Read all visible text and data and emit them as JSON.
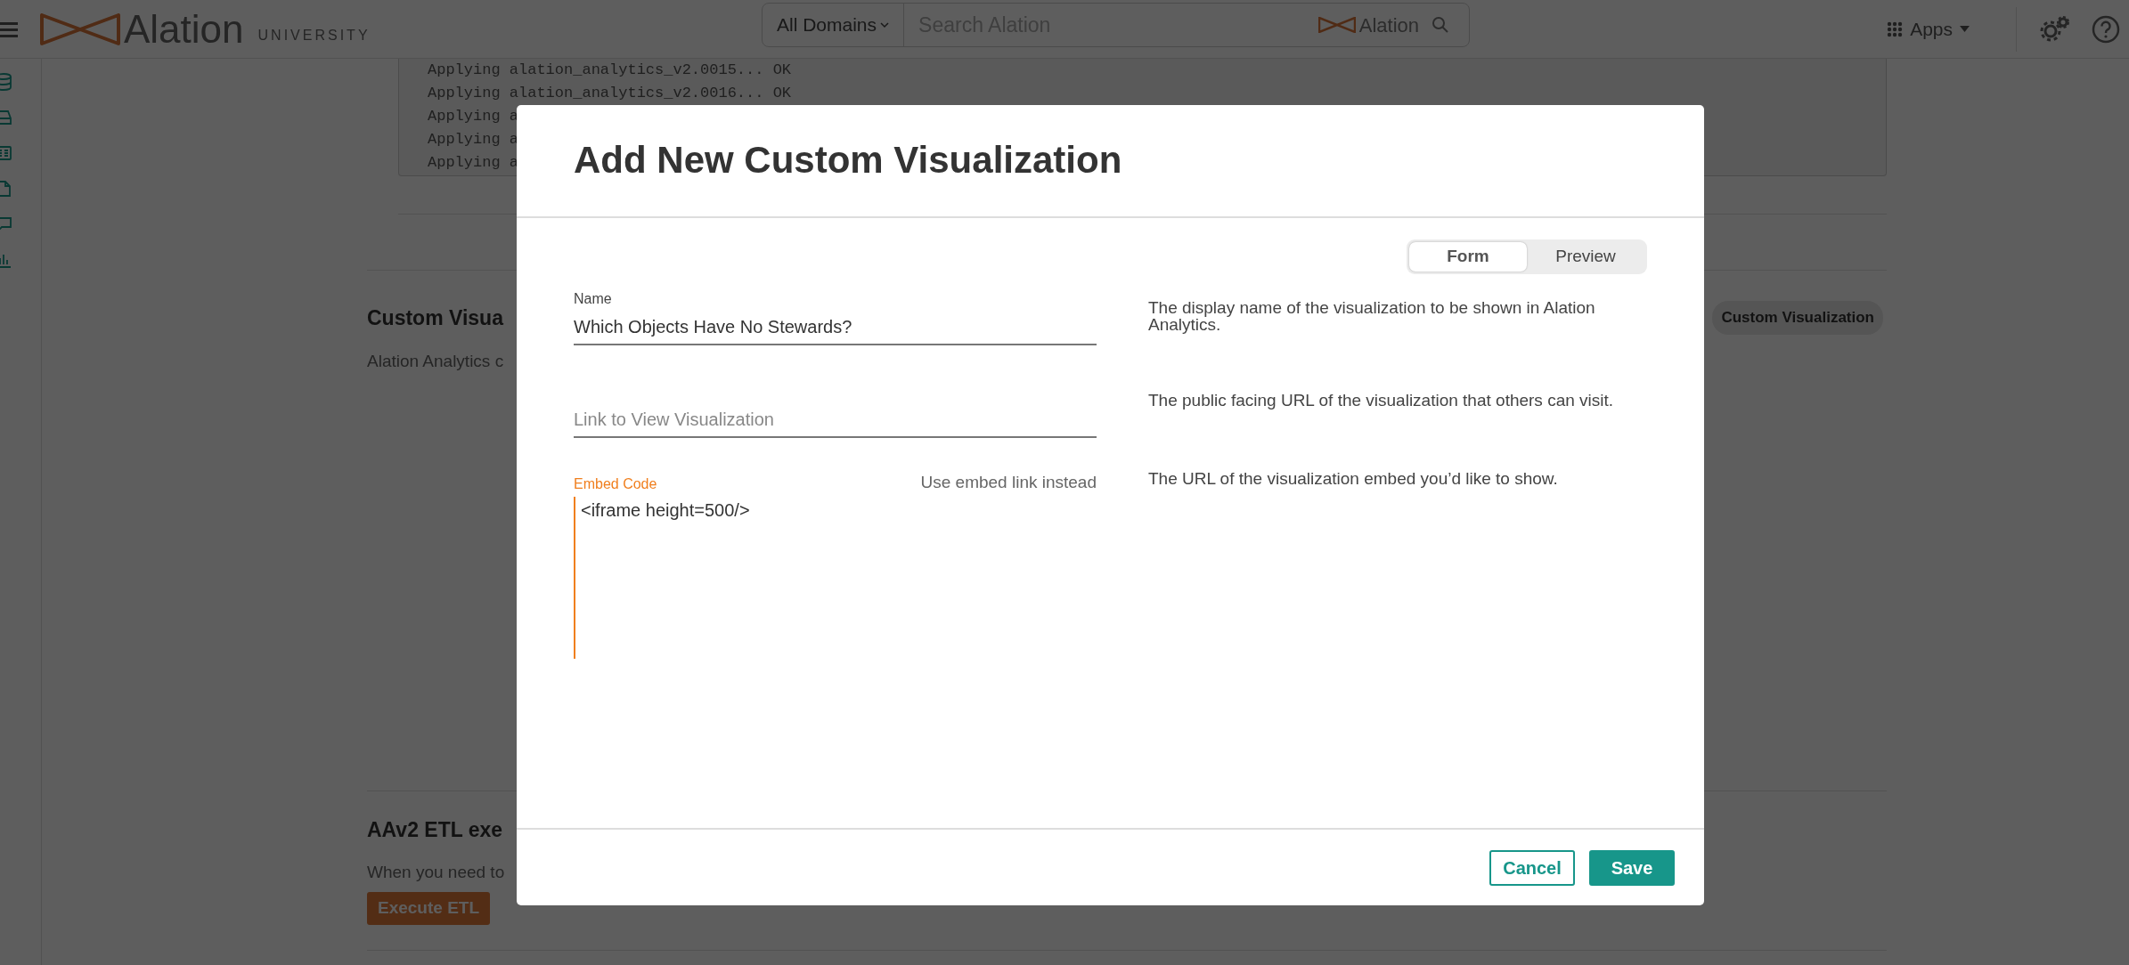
{
  "topbar": {
    "brand": "Alation",
    "brand_sub": "UNIVERSITY",
    "domain_select": "All Domains",
    "search": {
      "placeholder": "Search Alation",
      "brand": "Alation"
    },
    "apps": "Apps"
  },
  "background": {
    "log_lines": [
      "Applying alation_analytics_v2.0015... OK",
      "Applying alation_analytics_v2.0016... OK",
      "Applying a",
      "Applying a",
      "Applying a"
    ],
    "sections": [
      {
        "kind": "side",
        "title": "Custom Visua",
        "text": "Alation Analytics c",
        "button": "Custom Visualization"
      },
      {
        "kind": "below",
        "title": "AAv2 ETL exe",
        "text": "When you need to",
        "button": "Execute ETL"
      }
    ]
  },
  "modal": {
    "title": "Add New Custom Visualization",
    "view_toggle": [
      {
        "label": "Form",
        "selected": true
      },
      {
        "label": "Preview",
        "selected": false
      }
    ],
    "fields": [
      {
        "kind": "text",
        "label": "Name",
        "value": "Which Objects Have No Stewards?",
        "help": "The display name of the visualization to be shown in Alation Analytics."
      },
      {
        "kind": "text",
        "placeholder": "Link to View Visualization",
        "help": "The public facing URL of the visualization that others can visit."
      },
      {
        "kind": "code",
        "label": "Embed Code",
        "action": "Use embed link instead",
        "value": "<iframe height=500/>",
        "focused": true,
        "help": "The URL of the visualization embed you’d like to show."
      }
    ],
    "buttons": [
      {
        "label": "Cancel",
        "kind": "outline"
      },
      {
        "label": "Save",
        "kind": "primary"
      }
    ]
  }
}
